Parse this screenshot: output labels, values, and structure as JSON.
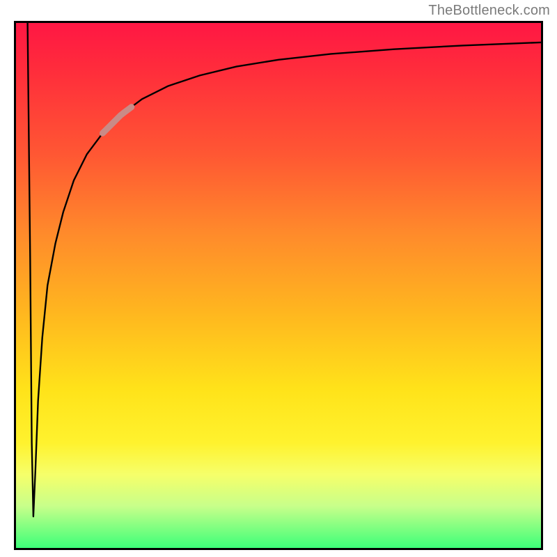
{
  "attribution": "TheBottleneck.com",
  "chart_data": {
    "type": "line",
    "title": "",
    "xlabel": "",
    "ylabel": "",
    "xlim": [
      0,
      100
    ],
    "ylim": [
      0,
      100
    ],
    "grid": false,
    "legend": false,
    "background": "vertical-gradient red→yellow→green",
    "series": [
      {
        "name": "bottleneck-curve",
        "x": [
          2.2,
          2.7,
          3.0,
          3.3,
          3.7,
          4.2,
          5.0,
          6.0,
          7.5,
          9.0,
          11.0,
          13.5,
          16.5,
          20.0,
          24.0,
          29.0,
          35.0,
          42.0,
          50.0,
          60.0,
          72.0,
          85.0,
          100.0
        ],
        "values": [
          100,
          55,
          20,
          6,
          15,
          28,
          40,
          50,
          58,
          64,
          70,
          75,
          79,
          82.5,
          85.5,
          88,
          90,
          91.7,
          93,
          94.1,
          95,
          95.7,
          96.3
        ]
      }
    ],
    "highlight": {
      "series": "bottleneck-curve",
      "x_start": 16.5,
      "x_end": 22.0
    }
  }
}
